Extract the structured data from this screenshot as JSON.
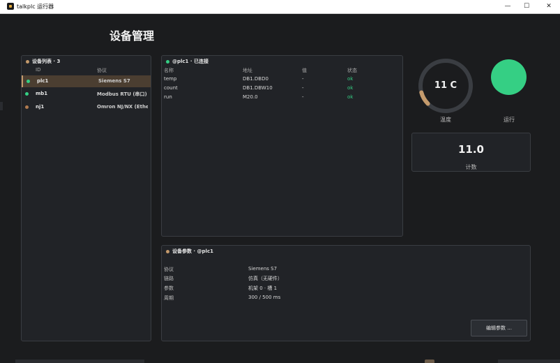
{
  "window": {
    "title": "talkplc 运行器",
    "minimize": "—",
    "maximize": "☐",
    "close": "✕"
  },
  "page": {
    "title": "设备管理"
  },
  "devices": {
    "header": "设备列表 · 3",
    "columns": {
      "id": "ID",
      "protocol": "协议"
    },
    "rows": [
      {
        "id": "plc1",
        "protocol": "Siemens S7",
        "status_color": "#35cf84",
        "selected": true
      },
      {
        "id": "mb1",
        "protocol": "Modbus RTU (串口)",
        "status_color": "#35cf84",
        "selected": false
      },
      {
        "id": "nj1",
        "protocol": "Omron NJ/NX (Ether",
        "status_color": "#b07a4f",
        "selected": false
      }
    ]
  },
  "variables": {
    "header": "@plc1 · 已连接",
    "columns": {
      "name": "名称",
      "address": "地址",
      "value": "值",
      "status": "状态"
    },
    "rows": [
      {
        "name": "temp",
        "address": "DB1.DBD0",
        "value": "-",
        "status": "ok"
      },
      {
        "name": "count",
        "address": "DB1.DBW10",
        "value": "-",
        "status": "ok"
      },
      {
        "name": "run",
        "address": "M20.0",
        "value": "-",
        "status": "ok"
      }
    ]
  },
  "widgets": {
    "temperature": {
      "value_text": "11 C",
      "label": "温度",
      "fraction": 0.11
    },
    "run": {
      "label": "运行",
      "on": true,
      "color": "#35cf84"
    },
    "counter": {
      "value": "11.0",
      "label": "计数"
    }
  },
  "params": {
    "header": "设备参数 · @plc1",
    "rows": [
      {
        "key": "协议",
        "value": "Siemens S7"
      },
      {
        "key": "链路",
        "value": "仿真（无硬件）"
      },
      {
        "key": "参数",
        "value": "机架 0 · 槽 1"
      },
      {
        "key": "周期",
        "value": "300 / 500 ms"
      }
    ],
    "edit_button": "编辑参数 ..."
  },
  "colors": {
    "accent": "#c49a6c",
    "ok": "#35cf84",
    "panel_bg": "#212327",
    "bg": "#1b1c1e"
  }
}
